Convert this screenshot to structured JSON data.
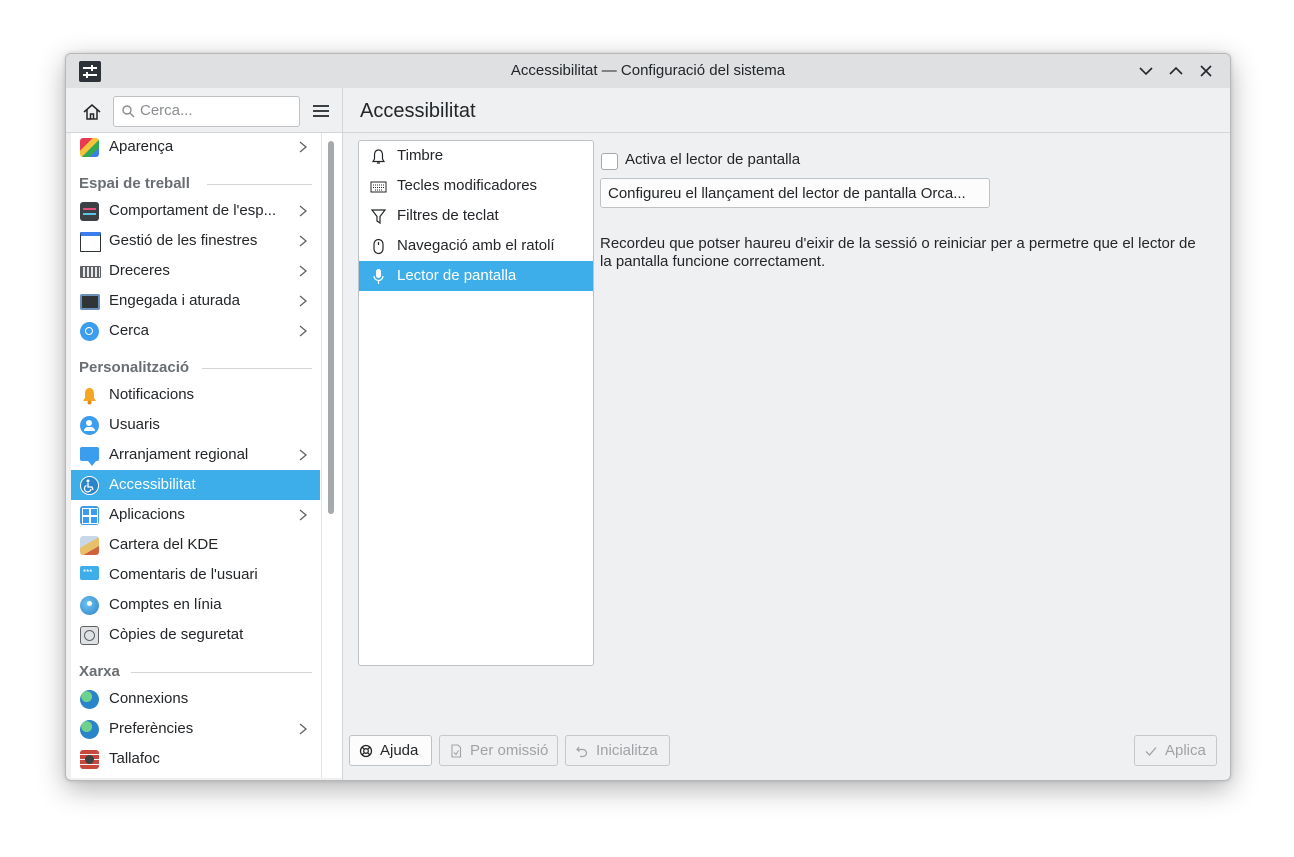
{
  "window": {
    "title": "Accessibilitat — Configuració del sistema"
  },
  "sidebar": {
    "search_placeholder": "Cerca...",
    "items": [
      {
        "label": "Aparença",
        "icon": "appearance-icon",
        "has_children": true
      },
      {
        "label": "Comportament de l'esp...",
        "icon": "workspace-behavior-icon",
        "has_children": true
      },
      {
        "label": "Gestió de les finestres",
        "icon": "window-management-icon",
        "has_children": true
      },
      {
        "label": "Dreceres",
        "icon": "keyboard-shortcuts-icon",
        "has_children": true
      },
      {
        "label": "Engegada i aturada",
        "icon": "startup-shutdown-icon",
        "has_children": true
      },
      {
        "label": "Cerca",
        "icon": "search-settings-icon",
        "has_children": true
      },
      {
        "label": "Notificacions",
        "icon": "bell-icon",
        "has_children": false
      },
      {
        "label": "Usuaris",
        "icon": "users-icon",
        "has_children": false
      },
      {
        "label": "Arranjament regional",
        "icon": "regional-settings-icon",
        "has_children": true
      },
      {
        "label": "Accessibilitat",
        "icon": "accessibility-icon",
        "has_children": false,
        "selected": true
      },
      {
        "label": "Aplicacions",
        "icon": "applications-icon",
        "has_children": true
      },
      {
        "label": "Cartera del KDE",
        "icon": "kde-wallet-icon",
        "has_children": false
      },
      {
        "label": "Comentaris de l'usuari",
        "icon": "user-feedback-icon",
        "has_children": false
      },
      {
        "label": "Comptes en línia",
        "icon": "online-accounts-icon",
        "has_children": false
      },
      {
        "label": "Còpies de seguretat",
        "icon": "backups-icon",
        "has_children": false
      },
      {
        "label": "Connexions",
        "icon": "connections-icon",
        "has_children": false
      },
      {
        "label": "Preferències",
        "icon": "network-preferences-icon",
        "has_children": true
      },
      {
        "label": "Tallafoc",
        "icon": "firewall-icon",
        "has_children": false
      }
    ],
    "sections": [
      "Espai de treball",
      "Personalització",
      "Xarxa"
    ]
  },
  "main": {
    "title": "Accessibilitat",
    "subcategories": [
      {
        "label": "Timbre",
        "icon": "bell-outline-icon"
      },
      {
        "label": "Tecles modificadores",
        "icon": "keyboard-icon"
      },
      {
        "label": "Filtres de teclat",
        "icon": "filter-icon"
      },
      {
        "label": "Navegació amb el ratolí",
        "icon": "mouse-icon"
      },
      {
        "label": "Lector de pantalla",
        "icon": "microphone-icon",
        "selected": true
      }
    ],
    "screen_reader_checkbox": {
      "label": "Activa el lector de pantalla",
      "checked": false
    },
    "configure_button": "Configureu el llançament del lector de pantalla Orca...",
    "note": "Recordeu que potser haureu d'eixir de la sessió o reiniciar per a permetre que el lector de la pantalla funcione correctament."
  },
  "footer": {
    "help": "Ajuda",
    "defaults": "Per omissió",
    "reset": "Inicialitza",
    "apply": "Aplica"
  },
  "colors": {
    "accent": "#3daee9",
    "window_bg": "#eff0f1",
    "text": "#232629"
  }
}
